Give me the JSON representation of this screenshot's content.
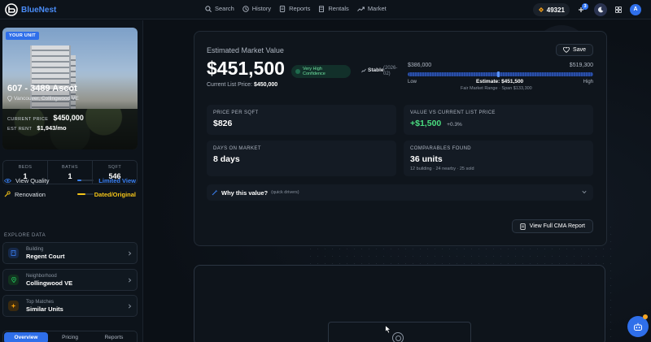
{
  "brand": {
    "name": "BlueNest"
  },
  "nav": {
    "items": [
      {
        "label": "Search",
        "icon": "search-icon"
      },
      {
        "label": "History",
        "icon": "history-icon"
      },
      {
        "label": "Reports",
        "icon": "document-icon"
      },
      {
        "label": "Rentals",
        "icon": "building-icon"
      },
      {
        "label": "Market",
        "icon": "trend-icon"
      }
    ]
  },
  "topbar": {
    "points": "49321",
    "notification_count": "3",
    "avatar_initial": "A"
  },
  "unit": {
    "badge": "YOUR UNIT",
    "title": "607 - 3489 Ascot",
    "location": "Vancouver, Collingwood VE",
    "current_price_label": "CURRENT PRICE",
    "current_price": "$450,000",
    "est_rent_label": "EST RENT",
    "est_rent": "$1,943/mo"
  },
  "stats": [
    {
      "label": "BEDS",
      "value": "1"
    },
    {
      "label": "BATHS",
      "value": "1"
    },
    {
      "label": "SQFT",
      "value": "546"
    }
  ],
  "features": [
    {
      "label": "View Quality",
      "value": "Limited View",
      "color": "#3b82f6",
      "level": 0.25
    },
    {
      "label": "Renovation",
      "value": "Dated/Original",
      "color": "#f5c518",
      "level": 0.5
    }
  ],
  "explore": {
    "title": "EXPLORE DATA",
    "items": [
      {
        "sub": "Building",
        "main": "Regent Court",
        "icon": "building-icon",
        "color": "#3b82f6"
      },
      {
        "sub": "Neighborhood",
        "main": "Collingwood VE",
        "icon": "map-pin-icon",
        "color": "#22c55e"
      },
      {
        "sub": "Top Matches",
        "main": "Similar Units",
        "icon": "sparkle-icon",
        "color": "#f59e0b"
      }
    ]
  },
  "tabs": [
    {
      "label": "Overview",
      "active": true
    },
    {
      "label": "Pricing",
      "active": false
    },
    {
      "label": "Reports",
      "active": false
    }
  ],
  "estimate": {
    "label": "Estimated Market Value",
    "save_label": "Save",
    "value": "$451,500",
    "confidence_line1": "Very High",
    "confidence_line2": "Confidence",
    "trend": "Stable",
    "trend_year_line1": "(2026-",
    "trend_year_line2": "02)",
    "list_price_label": "Current List Price:",
    "list_price": "$450,000",
    "range_low_value": "$386,000",
    "range_high_value": "$519,300",
    "range_position": 0.49,
    "low_label": "Low",
    "high_label": "High",
    "estimate_label": "Estimate: $451,500",
    "fair_range": "Fair Market Range · Span $133,300"
  },
  "metrics": {
    "price_per_sqft_label": "PRICE PER SQFT",
    "price_per_sqft": "$826",
    "vs_list_label": "VALUE VS CURRENT LIST PRICE",
    "vs_list_value": "+$1,500",
    "vs_list_pct": "+0.3%",
    "days_label": "DAYS ON MARKET",
    "days_value": "8 days",
    "comps_label": "COMPARABLES FOUND",
    "comps_value": "36 units",
    "comps_detail": "12 building · 24 nearby · 25 sold"
  },
  "why": {
    "label": "Why this value?",
    "sub": "(quick drivers)"
  },
  "cma": {
    "label": "View Full CMA Report"
  }
}
